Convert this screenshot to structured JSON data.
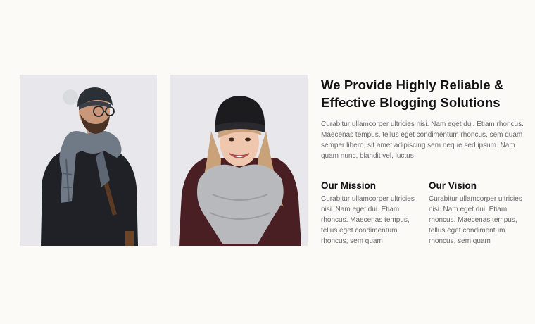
{
  "about": {
    "title": "We Provide Highly Reliable & Effective Blogging Solutions",
    "lead": "Curabitur ullamcorper ultricies nisi. Nam eget dui. Etiam rhoncus. Maecenas tempus, tellus eget condimentum rhoncus, sem quam semper libero, sit amet adipiscing sem neque sed ipsum. Nam quam nunc, blandit vel, luctus",
    "mission": {
      "heading": "Our Mission",
      "text": "Curabitur ullamcorper ultricies nisi. Nam eget dui. Etiam rhoncus. Maecenas tempus, tellus eget condimentum rhoncus, sem quam"
    },
    "vision": {
      "heading": "Our Vision",
      "text": "Curabitur ullamcorper ultricies nisi. Nam eget dui. Etiam rhoncus. Maecenas tempus, tellus eget condimentum rhoncus, sem quam"
    }
  },
  "colors": {
    "page_background": "#fcfaf6",
    "photo_background": "#e8e8ec",
    "heading_text": "#111111",
    "body_text": "#666666"
  }
}
